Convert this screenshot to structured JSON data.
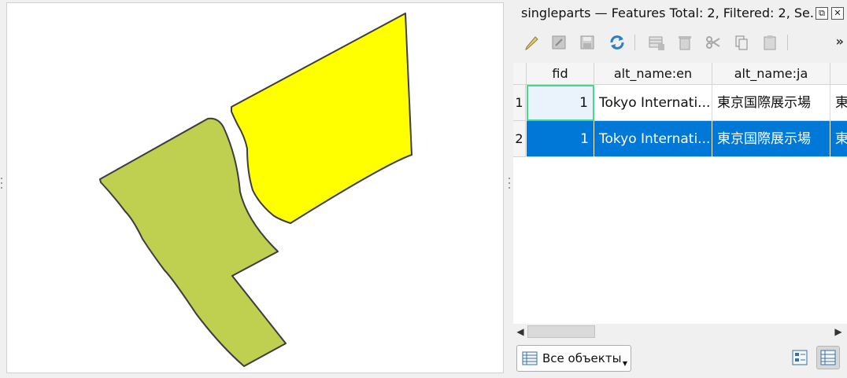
{
  "dock": {
    "title": "singleparts — Features Total: 2, Filtered: 2, Se...",
    "float_icon": "float-icon",
    "close_icon": "close-icon"
  },
  "toolbar": {
    "items": [
      "pencil-edit-icon",
      "multi-edit-icon",
      "save-icon",
      "reload-icon",
      "add-feature-icon",
      "delete-feature-icon",
      "cut-icon",
      "copy-icon",
      "paste-icon"
    ],
    "more_label": "»"
  },
  "table": {
    "columns": [
      "fid",
      "alt_name:en",
      "alt_name:ja"
    ],
    "rows": [
      {
        "num": "1",
        "fid": "1",
        "alt_name_en": "Tokyo Internati...",
        "alt_name_ja": "東京国際展示場",
        "extra": "東"
      },
      {
        "num": "2",
        "fid": "1",
        "alt_name_en": "Tokyo Internati...",
        "alt_name_ja": "東京国際展示場",
        "extra": "東"
      }
    ],
    "selected_row": 2
  },
  "footer": {
    "filter_label": "Все объекты"
  },
  "colors": {
    "feature_green": "#bfcf4f",
    "feature_yellow": "#ffff00",
    "selection_blue": "#0078d7",
    "focus_green": "#4cd58a"
  }
}
